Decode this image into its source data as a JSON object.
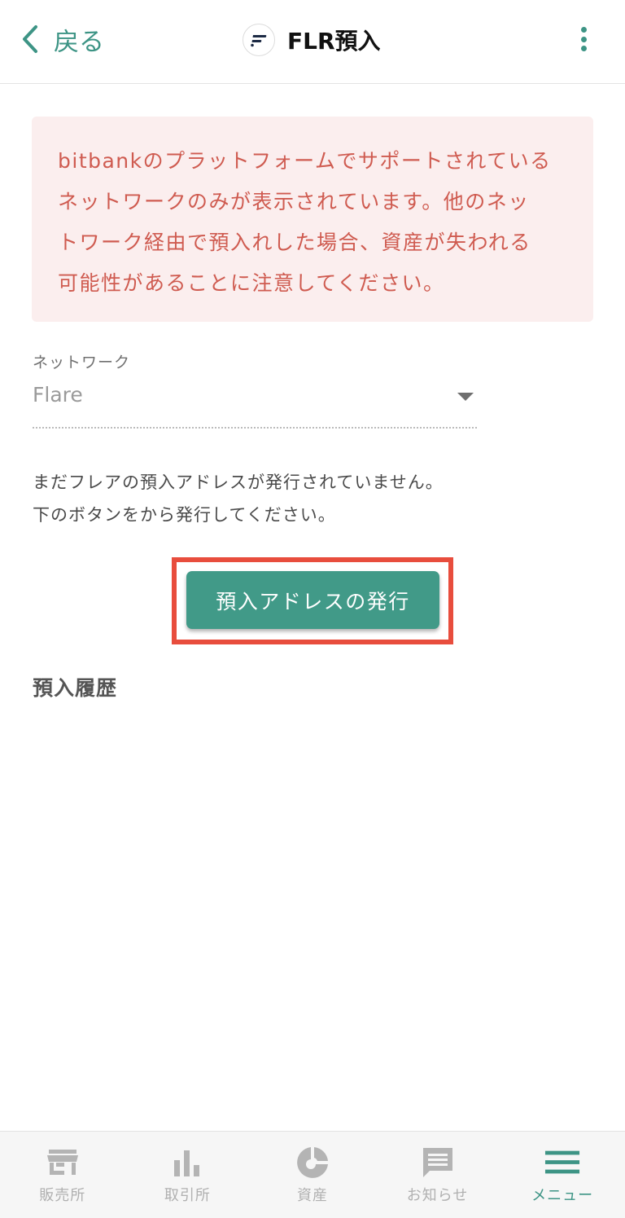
{
  "header": {
    "back_label": "戻る",
    "title": "FLR預入"
  },
  "warning": {
    "lines": [
      "bitbankのプラットフォームでサポートされている",
      "ネットワークのみが表示されています。他のネッ",
      "トワーク経由で預入れした場合、資産が失われる",
      "可能性があることに注意してください。"
    ]
  },
  "network": {
    "label": "ネットワーク",
    "selected": "Flare"
  },
  "info": {
    "line1": "まだフレアの預入アドレスが発行されていません。",
    "line2": "下のボタンをから発行してください。"
  },
  "issue_button": {
    "label": "預入アドレスの発行"
  },
  "history": {
    "title": "預入履歴"
  },
  "bottom_nav": {
    "items": [
      {
        "label": "販売所",
        "icon": "store-icon"
      },
      {
        "label": "取引所",
        "icon": "bar-chart-icon"
      },
      {
        "label": "資産",
        "icon": "pie-chart-icon"
      },
      {
        "label": "お知らせ",
        "icon": "message-icon"
      },
      {
        "label": "メニュー",
        "icon": "menu-icon",
        "active": true
      }
    ]
  },
  "colors": {
    "accent": "#3d9485",
    "button": "#419a88",
    "warning_bg": "#fbeeee",
    "warning_text": "#cf5b50",
    "highlight": "#e84d3d"
  }
}
